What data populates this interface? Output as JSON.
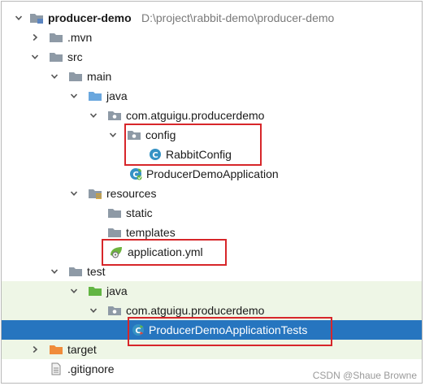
{
  "tree": {
    "rows": [
      {
        "label": "producer-demo",
        "path": "D:\\project\\rabbit-demo\\producer-demo",
        "icon": "module-folder-icon",
        "expanded": true
      },
      {
        "label": ".mvn",
        "icon": "folder-icon",
        "expanded": false
      },
      {
        "label": "src",
        "icon": "folder-icon",
        "expanded": true
      },
      {
        "label": "main",
        "icon": "folder-icon",
        "expanded": true
      },
      {
        "label": "java",
        "icon": "source-root-folder-icon",
        "expanded": true
      },
      {
        "label": "com.atguigu.producerdemo",
        "icon": "package-icon",
        "expanded": true
      },
      {
        "label": "config",
        "icon": "package-icon",
        "expanded": true
      },
      {
        "label": "RabbitConfig",
        "icon": "class-icon"
      },
      {
        "label": "ProducerDemoApplication",
        "icon": "spring-boot-class-icon"
      },
      {
        "label": "resources",
        "icon": "resources-folder-icon",
        "expanded": true
      },
      {
        "label": "static",
        "icon": "folder-icon"
      },
      {
        "label": "templates",
        "icon": "folder-icon"
      },
      {
        "label": "application.yml",
        "icon": "spring-yml-icon"
      },
      {
        "label": "test",
        "icon": "folder-icon",
        "expanded": true
      },
      {
        "label": "java",
        "icon": "test-root-folder-icon",
        "expanded": true
      },
      {
        "label": "com.atguigu.producerdemo",
        "icon": "package-icon",
        "expanded": true
      },
      {
        "label": "ProducerDemoApplicationTests",
        "icon": "test-class-icon",
        "selected": true
      },
      {
        "label": "target",
        "icon": "excluded-folder-icon",
        "expanded": false
      },
      {
        "label": ".gitignore",
        "icon": "file-icon"
      }
    ]
  },
  "colors": {
    "selection": "#2675bf",
    "highlight_box": "#d7262a",
    "test_background": "#eef6e6"
  },
  "watermark": "CSDN @Shaue Browne"
}
